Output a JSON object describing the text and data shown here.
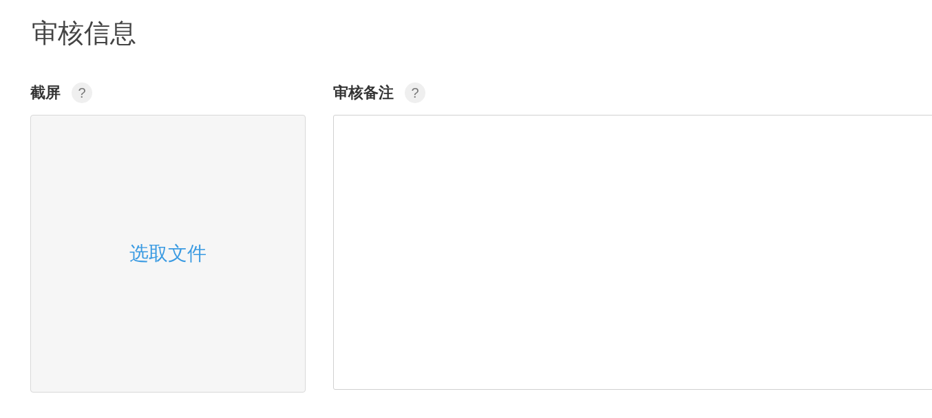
{
  "title": "审核信息",
  "screenshot": {
    "label": "截屏",
    "help": "?",
    "button": "选取文件"
  },
  "notes": {
    "label": "审核备注",
    "help": "?"
  }
}
